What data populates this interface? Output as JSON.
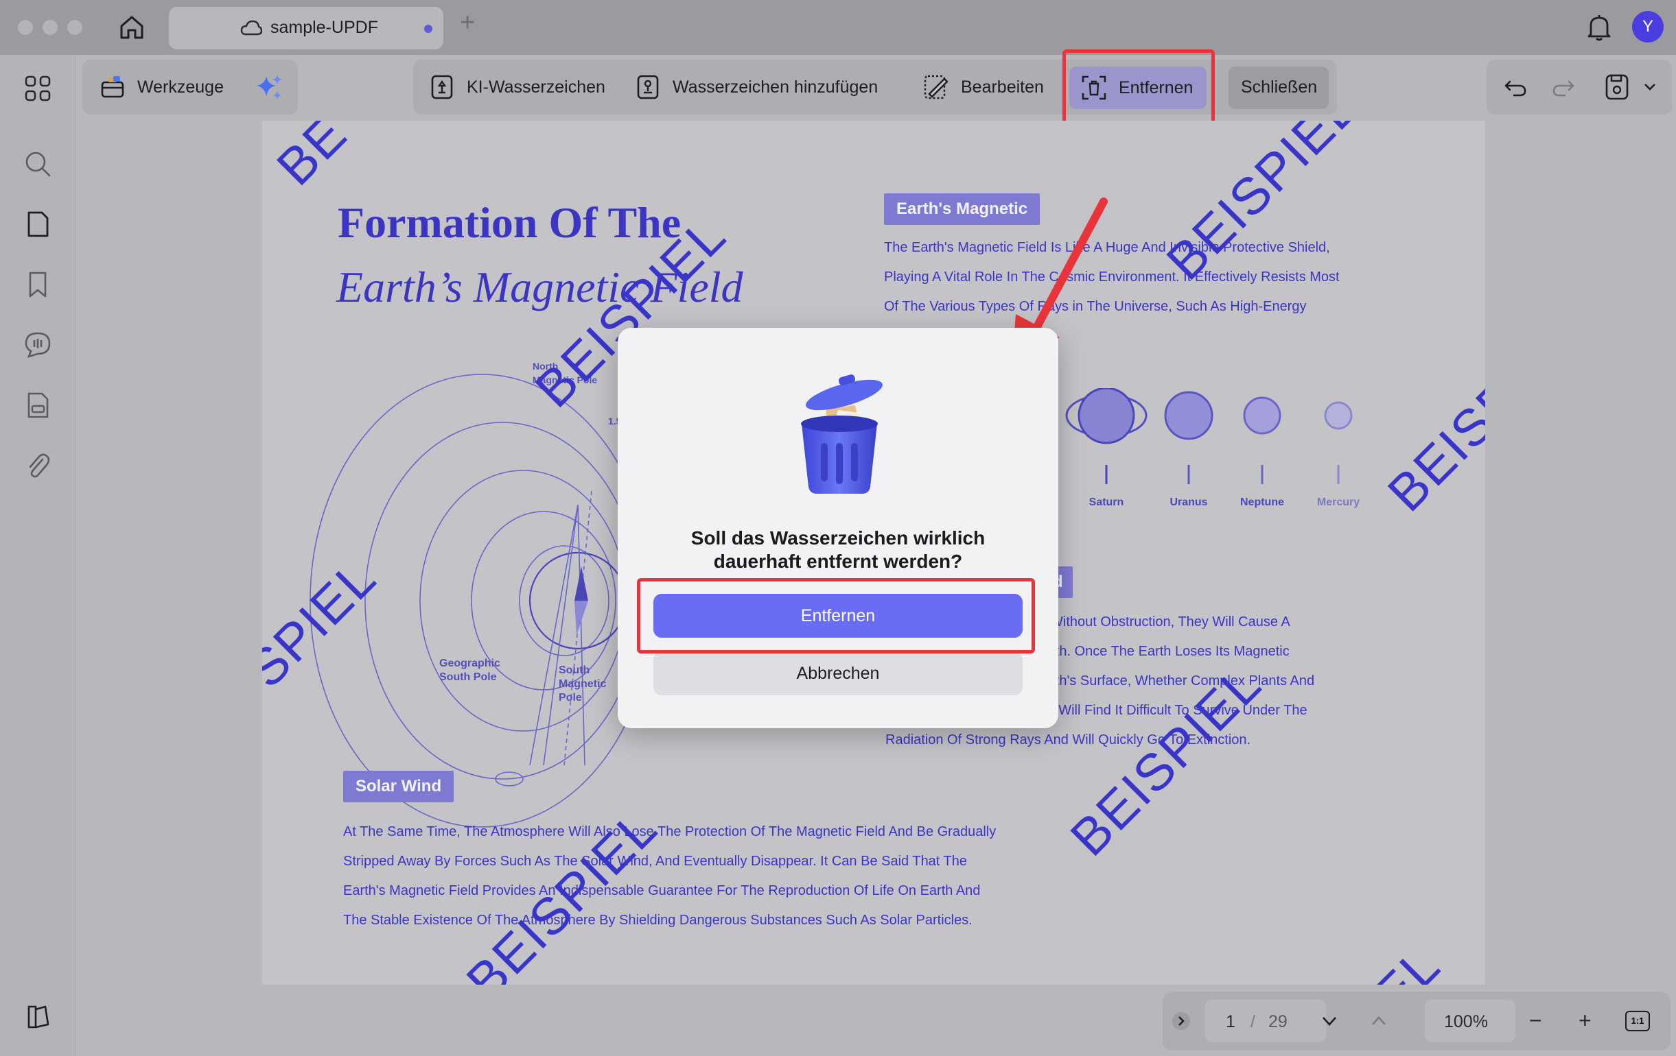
{
  "window": {
    "tab_title": "sample-UPDF",
    "tab_add": "+",
    "avatar_letter": "Y"
  },
  "toolbar": {
    "tools_label": "Werkzeuge",
    "ai_watermark": "KI-Wasserzeichen",
    "add_watermark": "Wasserzeichen hinzufügen",
    "edit": "Bearbeiten",
    "remove": "Entfernen",
    "close": "Schließen"
  },
  "document": {
    "title_line1": "Formation Of The",
    "title_line2": "Earth’s Magnetic Field",
    "section_magnetic": "Earth's Magnetic",
    "section_field_suffix": "eld",
    "section_solar": "Solar Wind",
    "para_magnetic": [
      "The Earth's Magnetic Field Is Like A Huge And Invisible Protective Shield,",
      "Playing A Vital Role In The Cosmic Environment. It Effectively Resists Most",
      "Of The Various Types Of Rays in The Universe, Such As High-Energy"
    ],
    "para_field": [
      "arth Without Obstruction, They Will Cause A",
      "n Earth. Once The Earth Loses Its Magnetic",
      "e Earth's Surface, Whether Complex Plants And",
      "isms, Will Find It Difficult To Survive Under The",
      "Radiation Of Strong Rays And Will Quickly Go To Extinction."
    ],
    "para_solar": [
      "At The Same Time, The Atmosphere Will Also Lose The Protection Of The Magnetic Field And Be Gradually",
      "Stripped Away By Forces Such As The Solar Wind, And Eventually Disappear. It Can Be Said That The",
      "Earth's Magnetic Field Provides An Indispensable Guarantee For The Reproduction Of Life On Earth And",
      "The Stable Existence Of The Atmosphere By Shielding Dangerous Substances Such As Solar Particles."
    ],
    "planets": [
      "Saturn",
      "Uranus",
      "Neptune",
      "Mercury"
    ],
    "diagram_labels": {
      "north_line1": "North",
      "north_line2": "Magnetic Pole",
      "angle": "1.5",
      "geo_line1": "Geographic",
      "geo_line2": "South Pole",
      "south_line1": "South",
      "south_line2": "Magnetic",
      "south_line3": "Pole"
    },
    "watermark_text": "BEISPIEL",
    "watermark_partial_left": "SPIEL",
    "watermark_partial_top": "BE",
    "watermark_partial_right": "BEISP",
    "watermark_partial_bottom": "EL"
  },
  "pager": {
    "current_page": "1",
    "separator": "/",
    "total_pages": "29",
    "zoom": "100%",
    "fit_label": "1:1",
    "zoom_out": "−",
    "zoom_in": "+"
  },
  "dialog": {
    "message_line1": "Soll das Wasserzeichen wirklich",
    "message_line2": "dauerhaft entfernt werden?",
    "confirm_label": "Entfernen",
    "cancel_label": "Abbrechen"
  },
  "colors": {
    "accent": "#6a6df3",
    "watermark": "#3a35c9",
    "highlight": "#e8353b"
  }
}
